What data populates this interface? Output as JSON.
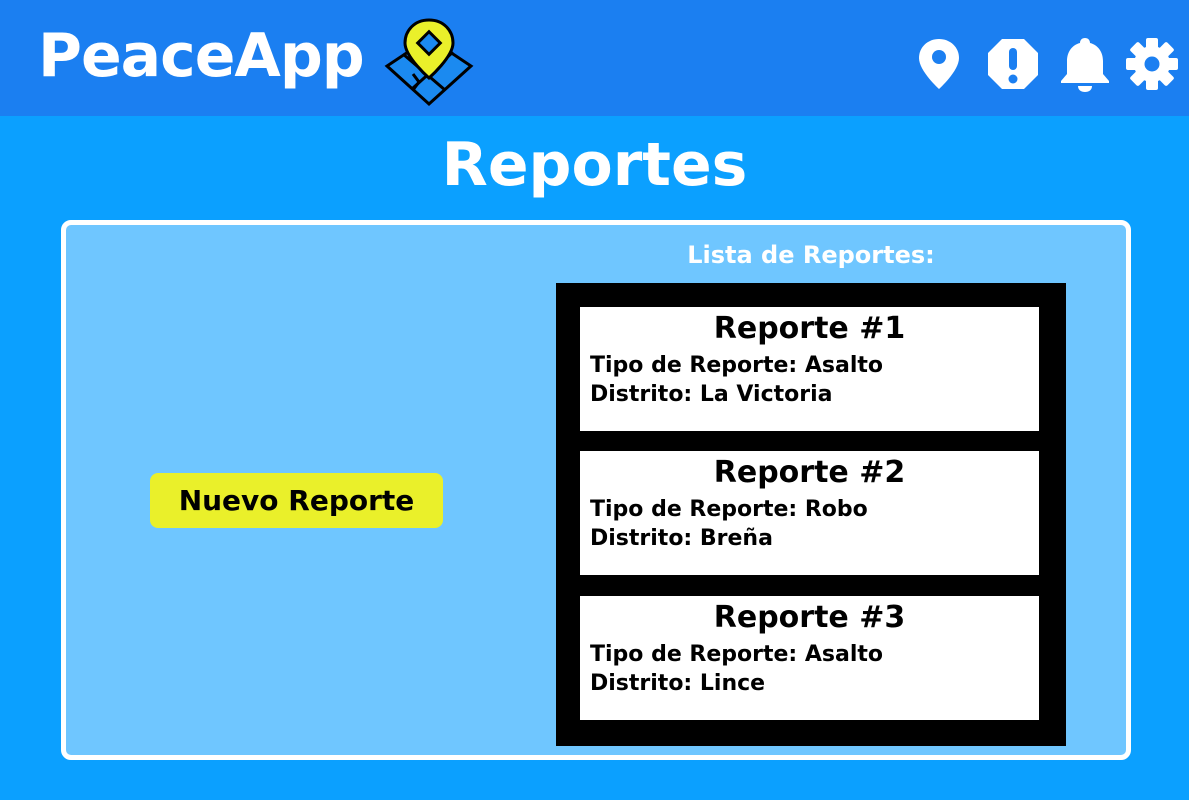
{
  "app": {
    "name": "PeaceApp"
  },
  "header": {
    "icons": [
      "location-pin-icon",
      "alert-icon",
      "bell-icon",
      "gear-icon"
    ]
  },
  "page": {
    "title": "Reportes"
  },
  "actions": {
    "new_report_label": "Nuevo Reporte"
  },
  "reports": {
    "list_title": "Lista de Reportes:",
    "items": [
      {
        "title": "Reporte #1",
        "type": "Tipo de Reporte: Asalto",
        "district": "Distrito: La Victoria"
      },
      {
        "title": "Reporte #2",
        "type": "Tipo de Reporte: Robo",
        "district": "Distrito: Breña"
      },
      {
        "title": "Reporte #3",
        "type": "Tipo de Reporte: Asalto",
        "district": "Distrito: Lince"
      }
    ]
  },
  "colors": {
    "header": "#1b7ff1",
    "background": "#0ba0ff",
    "panel": "#6fc6ff",
    "button": "#eaf02a",
    "logo_pin": "#eaf02a",
    "logo_map": "#1b8af0"
  }
}
